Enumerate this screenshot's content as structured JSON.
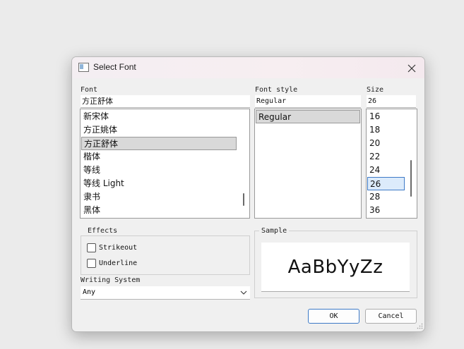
{
  "dialog": {
    "title": "Select Font",
    "font_label": "Font",
    "font_value": "方正舒体",
    "font_list": [
      "新宋体",
      "方正姚体",
      "方正舒体",
      "楷体",
      "等线",
      "等线 Light",
      "隶书",
      "黑体"
    ],
    "font_selected": "方正舒体",
    "style_label": "Font style",
    "style_value": "Regular",
    "style_list": [
      "Regular"
    ],
    "size_label": "Size",
    "size_value": "26",
    "size_list": [
      "16",
      "18",
      "20",
      "22",
      "24",
      "26",
      "28",
      "36"
    ],
    "size_selected": "26",
    "effects": {
      "title": "Effects",
      "strikeout": "Strikeout",
      "underline": "Underline"
    },
    "sample": {
      "title": "Sample",
      "text": "AaBbYyZz"
    },
    "writing_system": {
      "label": "Writing System",
      "value": "Any"
    },
    "ok_label": "OK",
    "cancel_label": "Cancel"
  },
  "icons": {
    "close": "close-icon",
    "dropdown": "chevron-down-icon"
  },
  "colors": {
    "selection_blue": "#3d7ac7",
    "selection_gray": "#d9d9d9"
  }
}
